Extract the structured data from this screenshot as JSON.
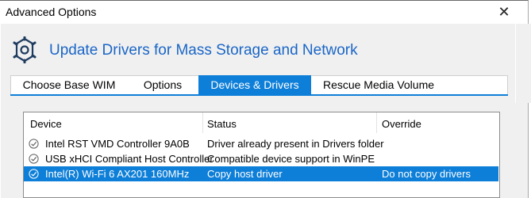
{
  "window": {
    "title": "Advanced Options",
    "close_glyph": "✕"
  },
  "header": {
    "icon": "gear-icon",
    "heading": "Update Drivers for Mass Storage and Network"
  },
  "tabs": [
    {
      "label": "Choose Base WIM",
      "active": false
    },
    {
      "label": "Options",
      "active": false
    },
    {
      "label": "Devices & Drivers",
      "active": true
    },
    {
      "label": "Rescue Media Volume",
      "active": false
    }
  ],
  "device_list": {
    "columns": [
      "Device",
      "Status",
      "Override"
    ],
    "rows": [
      {
        "icon": "check-circle-icon",
        "device": "Intel RST VMD Controller 9A0B",
        "status": "Driver already present in Drivers folder",
        "override": "",
        "selected": false
      },
      {
        "icon": "check-circle-icon",
        "device": "USB xHCI Compliant Host Controller",
        "status": "Compatible device support in WinPE",
        "override": "",
        "selected": false
      },
      {
        "icon": "check-circle-icon",
        "device": "Intel(R) Wi-Fi 6 AX201 160MHz",
        "status": "Copy host driver",
        "override": "Do not copy drivers",
        "selected": true
      }
    ]
  },
  "colors": {
    "accent": "#0e7fd8",
    "heading": "#1a66c7",
    "panel_bg": "#f0f0f0"
  }
}
